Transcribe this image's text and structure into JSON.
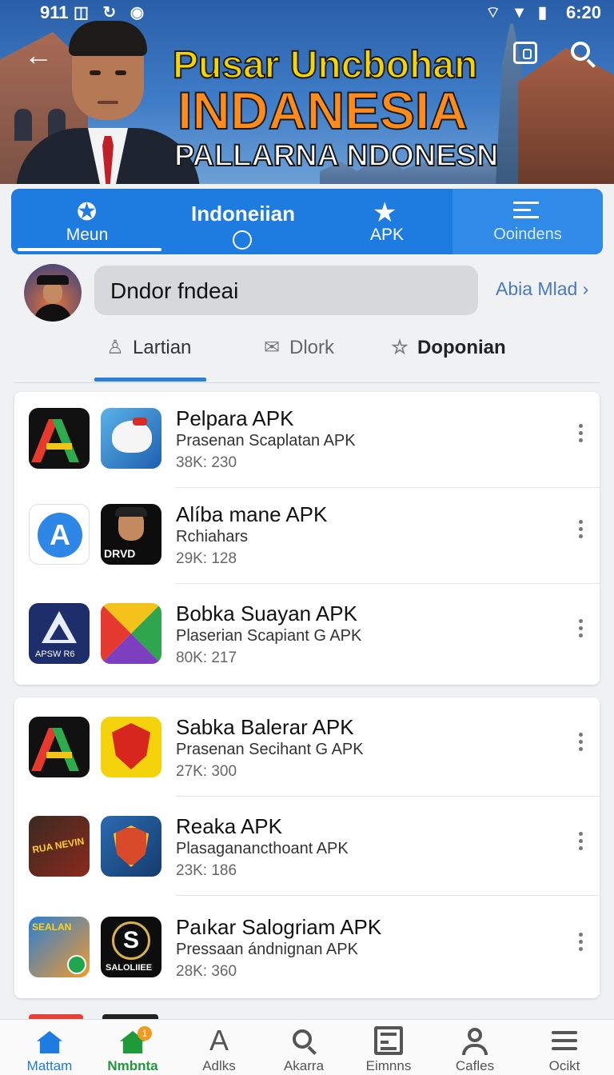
{
  "status_bar": {
    "time_left": "911",
    "icons_left": "◫ ↻ ◉",
    "icons_right": "⌔ ▼ ▮",
    "time_right": "6:20"
  },
  "banner": {
    "title_line1": "Pusar Uncbohan",
    "title_line2": "INDANESIA",
    "title_line3": "PALLARNA NDONESN"
  },
  "top_tabs": {
    "menu_label": "Meun",
    "indo_label": "Indoneiian",
    "apk_label": "APK",
    "other_label": "Ooindens"
  },
  "profile": {
    "search_text": "Dndor fndeai",
    "more_link": "Abia Mlad ›"
  },
  "sub_tabs": {
    "tab1": "Lartian",
    "tab2": "Dlork",
    "tab3": "Doponian"
  },
  "apps": [
    {
      "name": "Pelpara APK",
      "sub": "Prasenan Scaplatan APK",
      "stat": "38K: 230"
    },
    {
      "name": "Alíba mane APK",
      "sub": "Rchiahars",
      "stat": "29K: 128"
    },
    {
      "name": "Bobka Suayan APK",
      "sub": "Plaserian Scapiant G APK",
      "stat": "80K: 217"
    },
    {
      "name": "Sabka Balerar APK",
      "sub": "Prasenan Secihant G APK",
      "stat": "27K: 300"
    },
    {
      "name": "Reaka APK",
      "sub": "Plasaganancthoant APK",
      "stat": "23K: 186"
    },
    {
      "name": "Paıkar Salogriam APK",
      "sub": "Pressaan ándnignan APK",
      "stat": "28K: 360"
    }
  ],
  "icon_text": {
    "store_letter": "A",
    "dj_text": "DRVD",
    "tri_text": "APSW R6",
    "war_text": "RUA NEVIN",
    "game_text": "SEALAN",
    "s_letter": "S",
    "s_text": "SALOLIIEE"
  },
  "bottom_nav": {
    "item1": "Mattam",
    "item2": "Nmbnta",
    "item2_badge": "1",
    "item3": "Adlks",
    "item4": "Akarra",
    "item5": "Eimnns",
    "item6": "Cafles",
    "item7": "Ocikt"
  }
}
